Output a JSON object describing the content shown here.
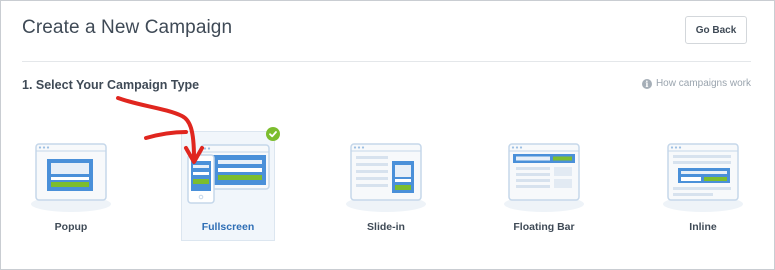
{
  "header": {
    "title": "Create a New Campaign",
    "back_label": "Go Back"
  },
  "section": {
    "title": "1. Select Your Campaign Type",
    "help_link": "How campaigns work"
  },
  "types": [
    {
      "label": "Popup",
      "icon": "popup-icon",
      "selected": false
    },
    {
      "label": "Fullscreen",
      "icon": "fullscreen-icon",
      "selected": true
    },
    {
      "label": "Slide-in",
      "icon": "slide-in-icon",
      "selected": false
    },
    {
      "label": "Floating Bar",
      "icon": "floating-bar-icon",
      "selected": false
    },
    {
      "label": "Inline",
      "icon": "inline-icon",
      "selected": false
    }
  ],
  "colors": {
    "accent_blue": "#4a90d9",
    "selected_text": "#2e6eb5",
    "green": "#7cbd2e",
    "annotation_red": "#e0261f"
  }
}
